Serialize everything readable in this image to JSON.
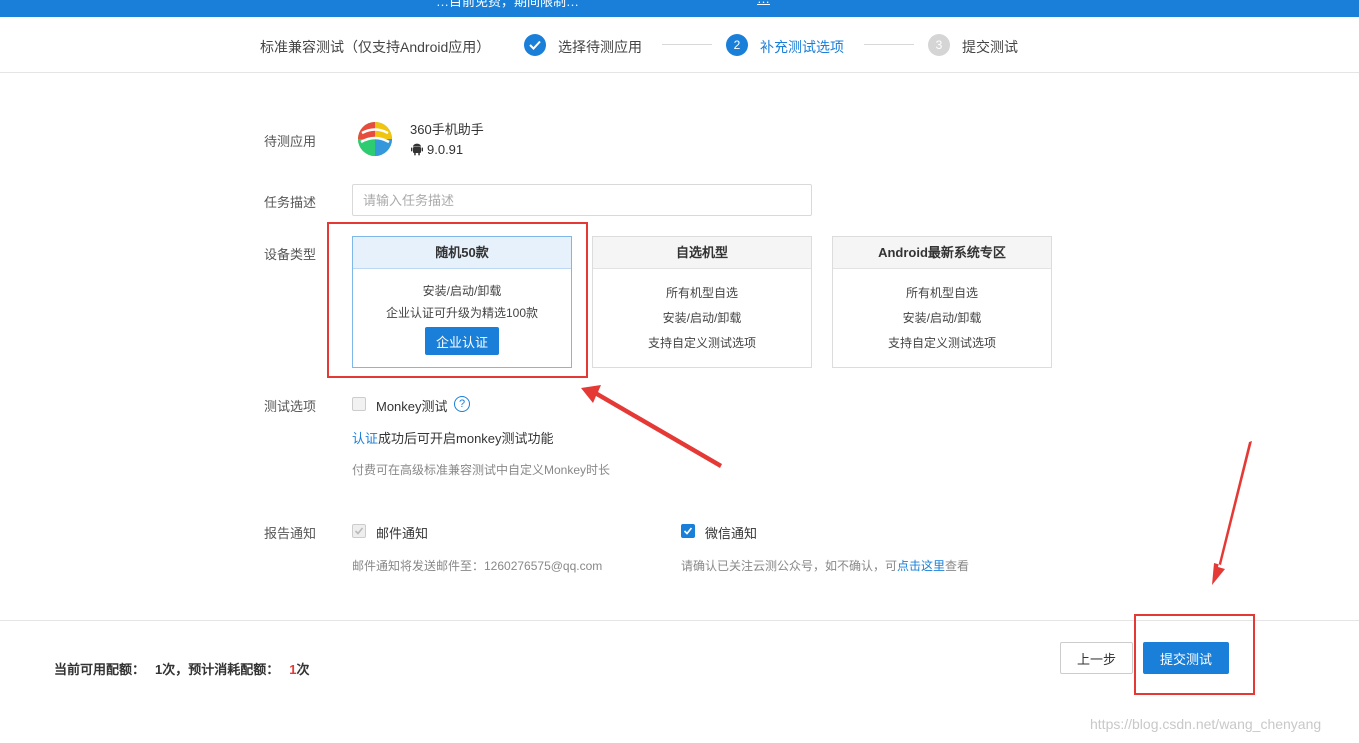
{
  "top_banner": {
    "text_left": "…目前免费，期间限制…",
    "text_link": "…"
  },
  "steps": {
    "title": "标准兼容测试（仅支持Android应用）",
    "items": [
      {
        "num": "✓",
        "label": "选择待测应用",
        "state": "done"
      },
      {
        "num": "2",
        "label": "补充测试选项",
        "state": "active"
      },
      {
        "num": "3",
        "label": "提交测试",
        "state": "pending"
      }
    ]
  },
  "form": {
    "app_label": "待测应用",
    "app_name": "360手机助手",
    "app_version": "9.0.91",
    "task_label": "任务描述",
    "task_placeholder": "请输入任务描述",
    "device_label": "设备类型",
    "device_cards": [
      {
        "title": "随机50款",
        "lines": [
          "安装/启动/卸载",
          "企业认证可升级为精选100款"
        ],
        "button": "企业认证",
        "selected": true
      },
      {
        "title": "自选机型",
        "lines": [
          "所有机型自选",
          "安装/启动/卸载",
          "支持自定义测试选项"
        ],
        "selected": false
      },
      {
        "title": "Android最新系统专区",
        "lines": [
          "所有机型自选",
          "安装/启动/卸载",
          "支持自定义测试选项"
        ],
        "selected": false
      }
    ],
    "test_option_label": "测试选项",
    "monkey_label": "Monkey测试",
    "monkey_hint_link": "认证",
    "monkey_hint_rest": "成功后可开启monkey测试功能",
    "monkey_hint_paid": "付费可在高级标准兼容测试中自定义Monkey时长",
    "notify_label": "报告通知",
    "email_label": "邮件通知",
    "email_hint": "邮件通知将发送邮件至：1260276575@qq.com",
    "wechat_label": "微信通知",
    "wechat_hint_pre": "请确认已关注云测公众号，如不确认，可",
    "wechat_hint_link": "点击这里",
    "wechat_hint_post": "查看"
  },
  "footer": {
    "quota_label": "当前可用配额：",
    "quota_value": "1次",
    "quota_sep": "，预计消耗配额：",
    "quota_cost_num": "1",
    "quota_cost_unit": "次",
    "prev_label": "上一步",
    "submit_label": "提交测试"
  },
  "watermark": "https://blog.csdn.net/wang_chenyang",
  "colors": {
    "accent": "#1a7fd9",
    "annotation": "#e53935"
  }
}
